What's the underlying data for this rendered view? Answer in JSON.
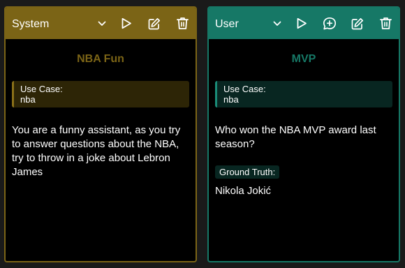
{
  "system_card": {
    "role": "System",
    "title": "NBA Fun",
    "use_case_label": "Use Case:",
    "use_case_value": "nba",
    "content": "You are a funny assistant, as you try to answer questions about the NBA, try to throw in a joke about Lebron James",
    "accent_color": "#7b6416",
    "icons": [
      "chevron-down-icon",
      "play-icon",
      "edit-icon",
      "trash-icon"
    ]
  },
  "user_card": {
    "role": "User",
    "title": "MVP",
    "use_case_label": "Use Case:",
    "use_case_value": "nba",
    "content": "Who won the NBA MVP award last season?",
    "ground_truth_label": "Ground Truth:",
    "ground_truth_value": "Nikola Jokić",
    "accent_color": "#167866",
    "icons": [
      "chevron-down-icon",
      "play-icon",
      "add-message-icon",
      "edit-icon",
      "trash-icon"
    ]
  }
}
